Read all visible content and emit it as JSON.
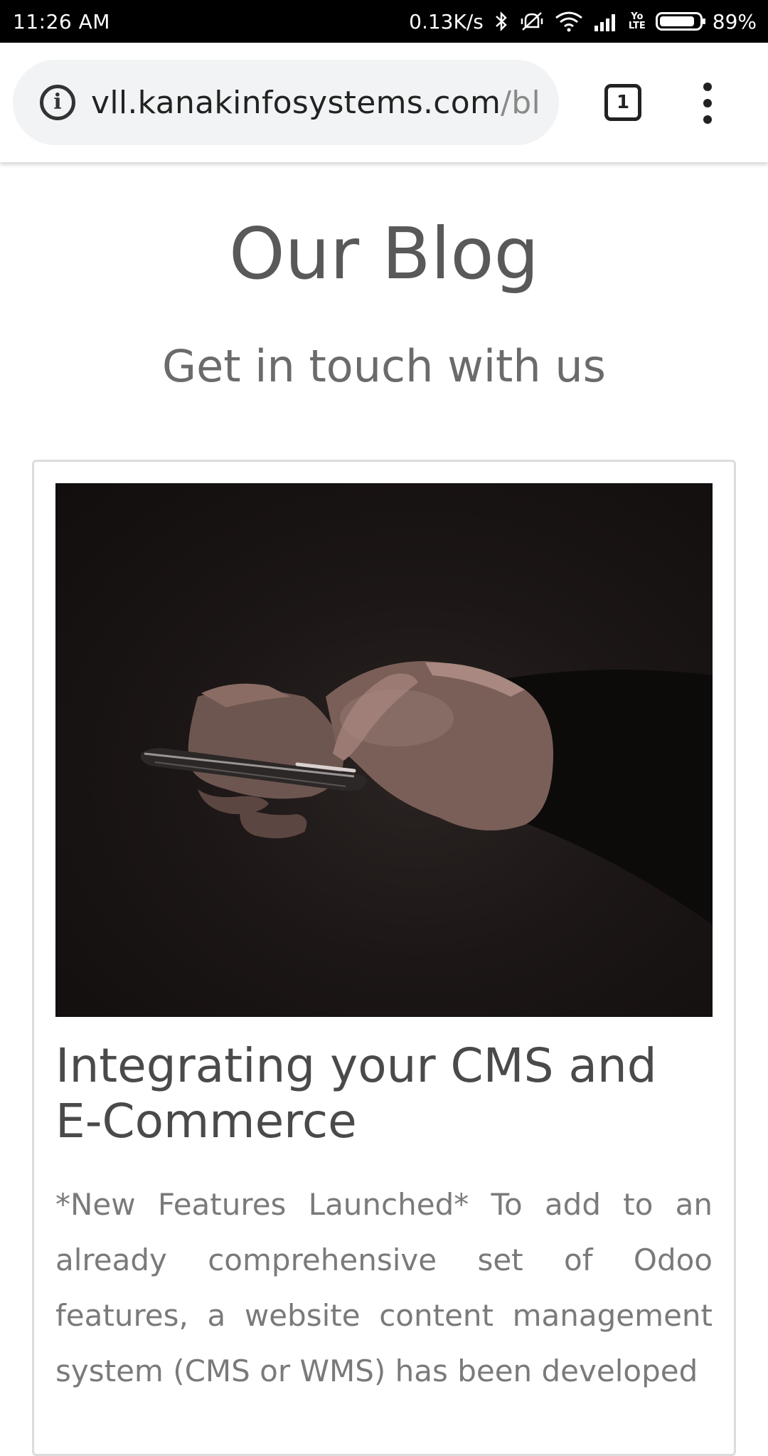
{
  "status_bar": {
    "time": "11:26 AM",
    "network_speed": "0.13K/s",
    "battery_percent": "89%",
    "battery_level": 0.89,
    "lte_label_top": "Yo",
    "lte_label_bottom": "LTE",
    "icons": [
      "bluetooth-icon",
      "vibrate-icon",
      "wifi-icon",
      "signal-icon",
      "lte-icon",
      "battery-icon"
    ]
  },
  "browser": {
    "url_domain": "vll.kanakinfosystems.com",
    "url_path": "/bl",
    "tab_count": "1",
    "icons": [
      "info-icon",
      "tab-switcher-icon",
      "menu-dots-icon"
    ]
  },
  "page": {
    "title": "Our Blog",
    "subtitle": "Get in touch with us",
    "post": {
      "image_alt_icon": "hands-holding-phone-photo",
      "title": "Integrating your CMS and E-Commerce",
      "excerpt": "*New Features Launched* To add to an already comprehensive set of Odoo features, a website content management system (CMS or WMS) has been developed"
    }
  },
  "colors": {
    "status_bar_bg": "#000000",
    "url_pill_bg": "#f1f3f4",
    "heading_text": "#595959",
    "excerpt_text": "#7a7a7a"
  }
}
